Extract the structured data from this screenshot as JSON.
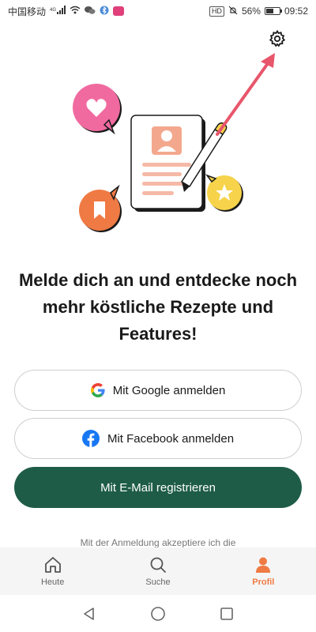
{
  "status_bar": {
    "carrier": "中国移动",
    "network": "4G",
    "hd_badge": "HD",
    "battery_percent": "56%",
    "time": "09:52"
  },
  "illustration": {
    "icons": [
      "heart-icon",
      "profile-document-icon",
      "pencil-icon",
      "bookmark-icon",
      "star-icon",
      "arrow-icon"
    ]
  },
  "headline": "Melde dich an und entdecke noch mehr köstliche Rezepte und Features!",
  "buttons": {
    "google": "Mit Google anmelden",
    "facebook": "Mit Facebook anmelden",
    "email": "Mit E-Mail registrieren"
  },
  "legal_text": "Mit der Anmeldung akzeptiere ich die",
  "tabs": [
    {
      "label": "Heute",
      "icon": "home-icon",
      "active": false
    },
    {
      "label": "Suche",
      "icon": "search-icon",
      "active": false
    },
    {
      "label": "Profil",
      "icon": "profile-icon",
      "active": true
    }
  ],
  "colors": {
    "accent_green": "#1e5c48",
    "accent_orange": "#f07a44",
    "pink": "#f06aa0",
    "yellow": "#f6d34a",
    "arrow_red": "#e8566b"
  }
}
